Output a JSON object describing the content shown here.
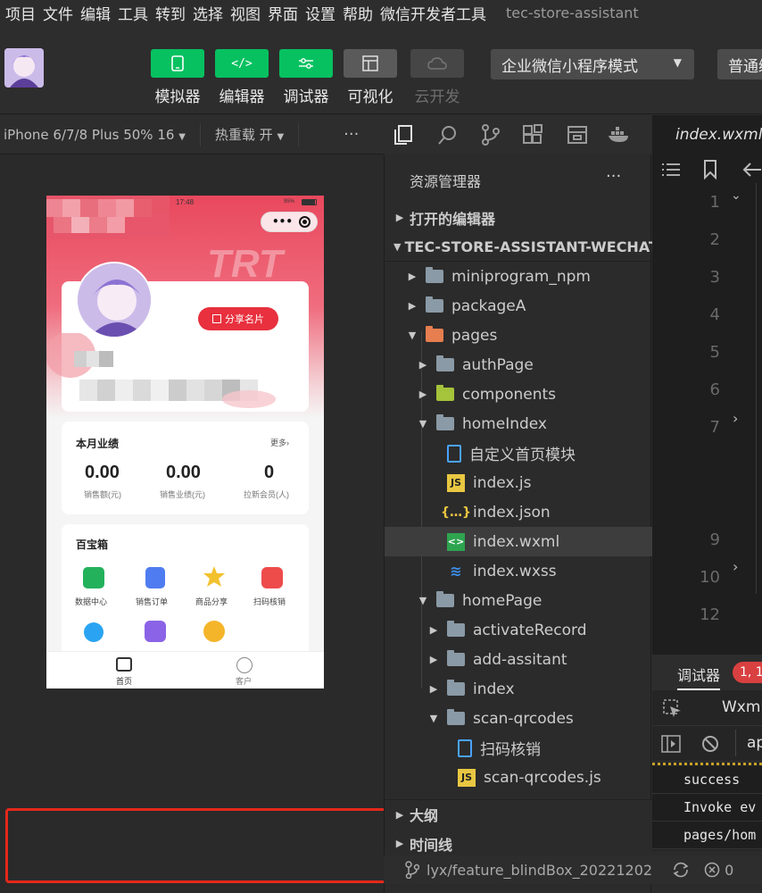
{
  "menubar": {
    "items": [
      "项目",
      "文件",
      "编辑",
      "工具",
      "转到",
      "选择",
      "视图",
      "界面",
      "设置",
      "帮助",
      "微信开发者工具"
    ],
    "app_title": "tec-store-assistant"
  },
  "toolbar": {
    "simulator_label": "模拟器",
    "editor_label": "编辑器",
    "debugger_label": "调试器",
    "visual_label": "可视化",
    "cloud_label": "云开发",
    "mode_select": "企业微信小程序模式",
    "normal_select": "普通编译"
  },
  "simulator": {
    "device": "iPhone 6/7/8 Plus 50% 16",
    "hot_reload": "热重载 开",
    "more": "···"
  },
  "phone": {
    "time": "17:48",
    "battery": "95%",
    "watermark": "TRT",
    "share_card": "分享名片",
    "perf_title": "本月业绩",
    "perf_more": "更多",
    "stats": [
      {
        "value": "0.00",
        "label": "销售额(元)"
      },
      {
        "value": "0.00",
        "label": "销售业绩(元)"
      },
      {
        "value": "0",
        "label": "拉新会员(人)"
      }
    ],
    "toolbox_title": "百宝箱",
    "tools": [
      "数据中心",
      "销售订单",
      "商品分享",
      "扫码核销"
    ],
    "tabbar": [
      "首页",
      "客户"
    ]
  },
  "explorer": {
    "title": "资源管理器",
    "more": "···",
    "open_editors": "打开的编辑器",
    "project": "TEC-STORE-ASSISTANT-WECHAT",
    "tree": [
      {
        "label": "miniprogram_npm",
        "type": "folder",
        "depth": 1
      },
      {
        "label": "packageA",
        "type": "folder",
        "depth": 1
      },
      {
        "label": "pages",
        "type": "folder-open",
        "depth": 1
      },
      {
        "label": "authPage",
        "type": "folder",
        "depth": 2
      },
      {
        "label": "components",
        "type": "folder-lime",
        "depth": 2
      },
      {
        "label": "homeIndex",
        "type": "folder-open",
        "depth": 2
      },
      {
        "label": "自定义首页模块",
        "type": "file-doc",
        "depth": 3
      },
      {
        "label": "index.js",
        "type": "file-js",
        "depth": 3
      },
      {
        "label": "index.json",
        "type": "file-json",
        "depth": 3
      },
      {
        "label": "index.wxml",
        "type": "file-wxml",
        "depth": 3,
        "selected": true
      },
      {
        "label": "index.wxss",
        "type": "file-wxss",
        "depth": 3
      },
      {
        "label": "homePage",
        "type": "folder-open",
        "depth": 2
      },
      {
        "label": "activateRecord",
        "type": "folder",
        "depth": 3
      },
      {
        "label": "add-assitant",
        "type": "folder",
        "depth": 3
      },
      {
        "label": "index",
        "type": "folder",
        "depth": 3
      },
      {
        "label": "scan-qrcodes",
        "type": "folder-open",
        "depth": 3
      },
      {
        "label": "扫码核销",
        "type": "file-doc",
        "depth": 4
      },
      {
        "label": "scan-qrcodes.js",
        "type": "file-js",
        "depth": 4
      }
    ],
    "outline": "大纲",
    "timeline": "时间线"
  },
  "editor": {
    "tab_label": "index.wxml",
    "line_numbers": [
      "1",
      "2",
      "3",
      "4",
      "5",
      "6",
      "7",
      "9",
      "10",
      "12"
    ]
  },
  "debugger": {
    "tab_label": "调试器",
    "badge": "1, 1",
    "panel_tab": "Wxml",
    "filter_stub": "ap",
    "console_lines": [
      "success",
      "Invoke ev",
      "pages/hom"
    ]
  },
  "statusbar": {
    "branch": "lyx/feature_blindBox_20221202",
    "errors": "0"
  },
  "colors": {
    "accent_green": "#07c160",
    "highlight_red": "#e5281b",
    "phone_brand_red": "#e8303e"
  }
}
